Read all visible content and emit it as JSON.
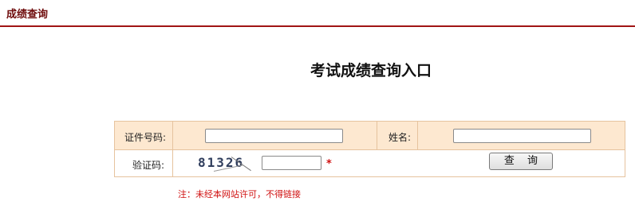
{
  "header": {
    "title": "成绩查询"
  },
  "page": {
    "title": "考试成绩查询入口"
  },
  "form": {
    "id_label": "证件号码:",
    "id_value": "",
    "name_label": "姓名:",
    "name_value": "",
    "captcha_label": "验证码:",
    "captcha_text": "81326",
    "captcha_value": "",
    "required_mark": "*",
    "submit_label": "查 询"
  },
  "notice": "注：未经本网站许可，不得链接",
  "colors": {
    "brand": "#6e0b0b",
    "rule": "#a01414",
    "row_bg": "#fde8d0",
    "border": "#e6c39e",
    "alert": "#d01010"
  }
}
